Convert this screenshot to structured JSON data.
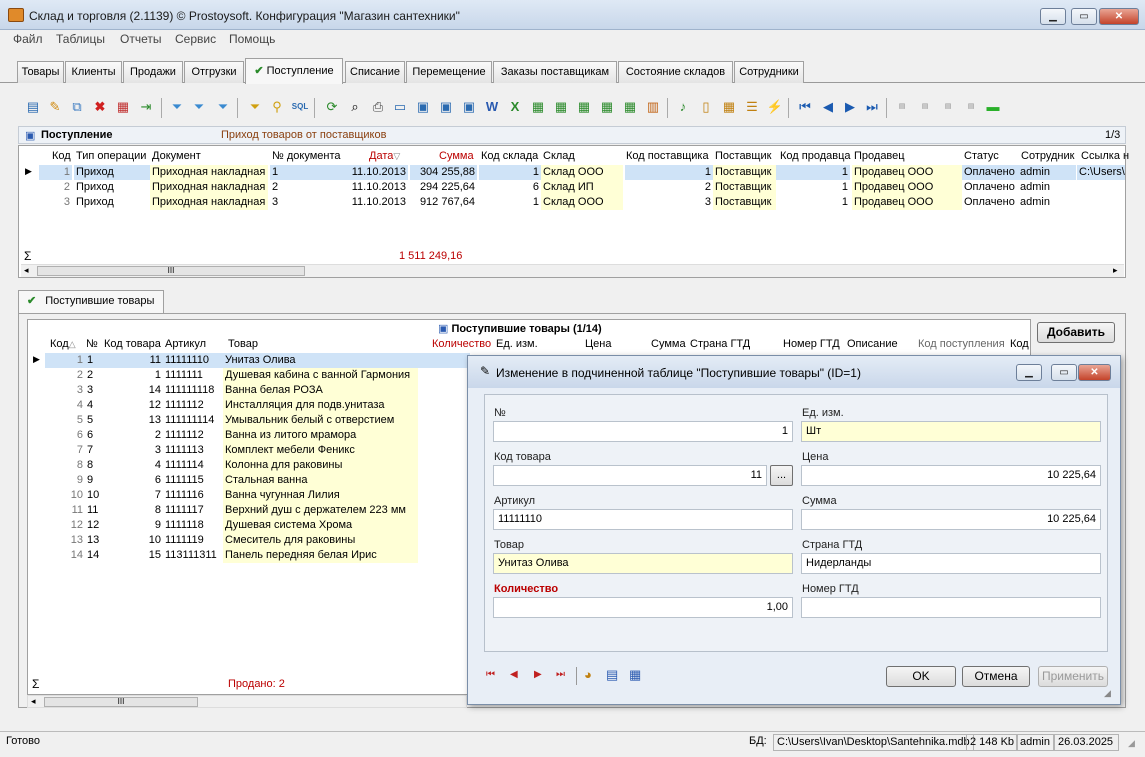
{
  "window": {
    "title": "Склад и торговля (2.1139) © Prostoysoft. Конфигурация \"Магазин сантехники\"",
    "min": "▁",
    "max": "▭",
    "close": "✕"
  },
  "menu": [
    "Файл",
    "Таблицы",
    "Отчеты",
    "Сервис",
    "Помощь"
  ],
  "tabs": [
    "Товары",
    "Клиенты",
    "Продажи",
    "Отгрузки",
    "Поступление",
    "Списание",
    "Перемещение",
    "Заказы поставщикам",
    "Состояние складов",
    "Сотрудники"
  ],
  "upper": {
    "title": "Поступление",
    "subtitle": "Приход товаров от поставщиков",
    "counter": "1/3",
    "headers": [
      "Код",
      "Тип операции",
      "Документ",
      "№ документа",
      "Дата",
      "Сумма",
      "Код склада",
      "Склад",
      "Код поставщика",
      "Поставщик",
      "Код продавца",
      "Продавец",
      "Статус",
      "Сотрудник",
      "Ссылка н"
    ],
    "rows": [
      [
        "1",
        "Приход",
        "Приходная накладная",
        "1",
        "11.10.2013",
        "304 255,88",
        "1",
        "Склад ООО",
        "1",
        "Поставщик",
        "1",
        "Продавец ООО",
        "Оплачено",
        "admin",
        "C:\\Users\\"
      ],
      [
        "2",
        "Приход",
        "Приходная накладная",
        "2",
        "11.10.2013",
        "294 225,64",
        "6",
        "Склад ИП",
        "2",
        "Поставщик",
        "1",
        "Продавец ООО",
        "Оплачено",
        "admin",
        ""
      ],
      [
        "3",
        "Приход",
        "Приходная накладная",
        "3",
        "11.10.2013",
        "912 767,64",
        "1",
        "Склад ООО",
        "3",
        "Поставщик",
        "1",
        "Продавец ООО",
        "Оплачено",
        "admin",
        ""
      ]
    ],
    "sum_symbol": "Σ",
    "total": "1 511 249,16",
    "scroll_grip": "III"
  },
  "subtab": "Поступившие товары",
  "lower": {
    "title": "Поступившие товары (1/14)",
    "headers": [
      "Код",
      "№",
      "Код товара",
      "Артикул",
      "Товар",
      "Количество",
      "Ед. изм.",
      "Цена",
      "Сумма",
      "Страна ГТД",
      "Номер ГТД",
      "Описание",
      "Код поступления",
      "Код"
    ],
    "rows": [
      [
        "1",
        "1",
        "11",
        "11111110",
        "Унитаз Олива"
      ],
      [
        "2",
        "2",
        "1",
        "1111111",
        "Душевая кабина с ванной Гармония"
      ],
      [
        "3",
        "3",
        "14",
        "111111118",
        "Ванна белая РОЗА"
      ],
      [
        "4",
        "4",
        "12",
        "1111112",
        "Инсталляция для подв.унитаза"
      ],
      [
        "5",
        "5",
        "13",
        "111111114",
        "Умывальник белый с отверстием"
      ],
      [
        "6",
        "6",
        "2",
        "1111112",
        "Ванна из литого мрамора"
      ],
      [
        "7",
        "7",
        "3",
        "1111113",
        "Комплект мебели Феникс"
      ],
      [
        "8",
        "8",
        "4",
        "1111114",
        "Колонна  для раковины"
      ],
      [
        "9",
        "9",
        "6",
        "1111115",
        "Стальная ванна"
      ],
      [
        "10",
        "10",
        "7",
        "1111116",
        "Ванна чугунная Лилия"
      ],
      [
        "11",
        "11",
        "8",
        "1111117",
        "Верхний душ с держателем 223 мм"
      ],
      [
        "12",
        "12",
        "9",
        "1111118",
        "Душевая система Хрома"
      ],
      [
        "13",
        "13",
        "10",
        "1111119",
        "Смеситель для раковины"
      ],
      [
        "14",
        "14",
        "15",
        "113111311",
        "Панель передняя белая Ирис"
      ]
    ],
    "sum_symbol": "Σ",
    "sold": "Продано: 2",
    "add_button": "Добавить",
    "scroll_grip": "III"
  },
  "dialog": {
    "title": "Изменение в подчиненной таблице \"Поступившие товары\" (ID=1)",
    "labels": {
      "no": "№",
      "unit": "Ед. изм.",
      "code": "Код товара",
      "price": "Цена",
      "article": "Артикул",
      "sum": "Сумма",
      "name": "Товар",
      "country": "Страна ГТД",
      "qty": "Количество",
      "gtd": "Номер ГТД"
    },
    "values": {
      "no": "1",
      "unit": "Шт",
      "code": "11",
      "price": "10 225,64",
      "article": "11111110",
      "sum": "10 225,64",
      "name": "Унитаз Олива",
      "country": "Нидерланды",
      "qty": "1,00",
      "gtd": ""
    },
    "browse": "...",
    "ok": "OK",
    "cancel": "Отмена",
    "apply": "Применить"
  },
  "status": {
    "ready": "Готово",
    "db_label": "БД:",
    "db_path": "C:\\Users\\Ivan\\Desktop\\Santehnika.mdb",
    "size": "2 148 Kb",
    "user": "admin",
    "date": "26.03.2025"
  },
  "colors": {
    "accent_red": "#b00000",
    "highlight_yellow": "#ffffd6",
    "selection": "#cfe3f7"
  }
}
